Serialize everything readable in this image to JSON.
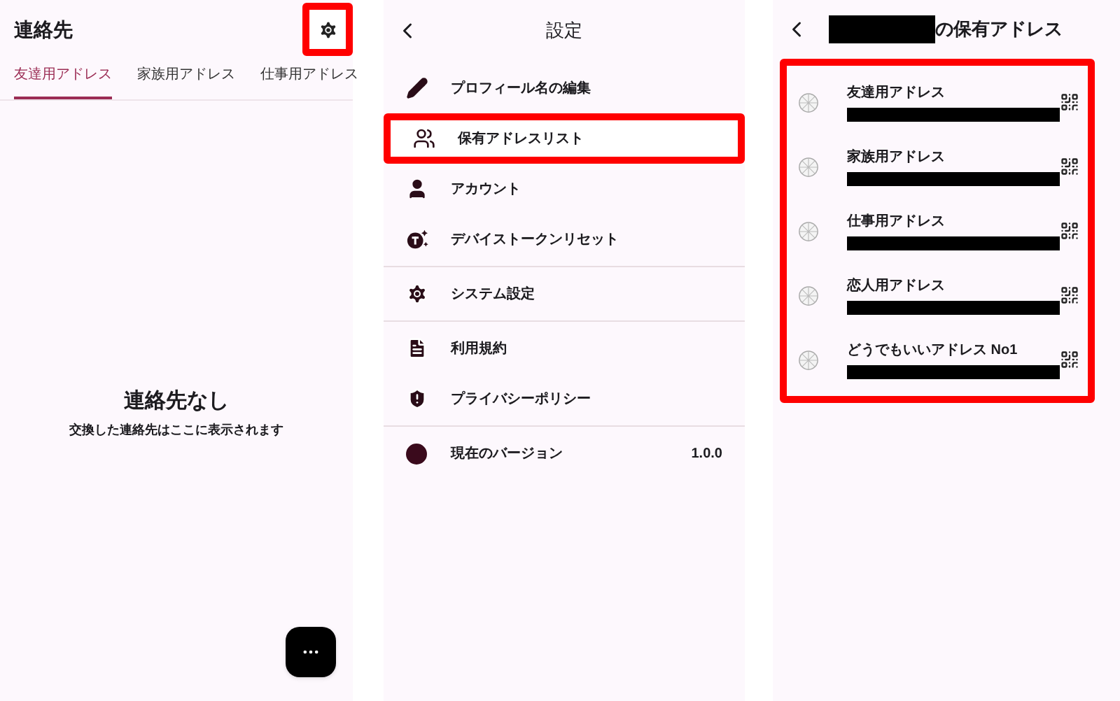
{
  "contacts": {
    "title": "連絡先",
    "settings_highlighted": true,
    "tabs": [
      {
        "label": "友達用アドレス",
        "selected": true
      },
      {
        "label": "家族用アドレス",
        "selected": false
      },
      {
        "label": "仕事用アドレス",
        "selected": false
      }
    ],
    "empty_title": "連絡先なし",
    "empty_message": "交換した連絡先はここに表示されます"
  },
  "settings": {
    "title": "設定",
    "sections": [
      {
        "items": [
          {
            "label": "プロフィール名の編集",
            "highlighted": false
          },
          {
            "label": "保有アドレスリスト",
            "highlighted": true
          },
          {
            "label": "アカウント",
            "highlighted": false
          },
          {
            "label": "デバイストークンリセット",
            "highlighted": false
          }
        ]
      },
      {
        "items": [
          {
            "label": "システム設定",
            "highlighted": false
          }
        ]
      },
      {
        "items": [
          {
            "label": "利用規約",
            "highlighted": false
          },
          {
            "label": "プライバシーポリシー",
            "highlighted": false
          }
        ]
      },
      {
        "items": [
          {
            "label": "現在のバージョン",
            "value": "1.0.0",
            "highlighted": false
          }
        ]
      }
    ]
  },
  "addresses": {
    "title_suffix": "の保有アドレス",
    "highlighted": true,
    "items": [
      {
        "name": "友達用アドレス"
      },
      {
        "name": "家族用アドレス"
      },
      {
        "name": "仕事用アドレス"
      },
      {
        "name": "恋人用アドレス"
      },
      {
        "name": "どうでもいいアドレス No1"
      }
    ]
  }
}
